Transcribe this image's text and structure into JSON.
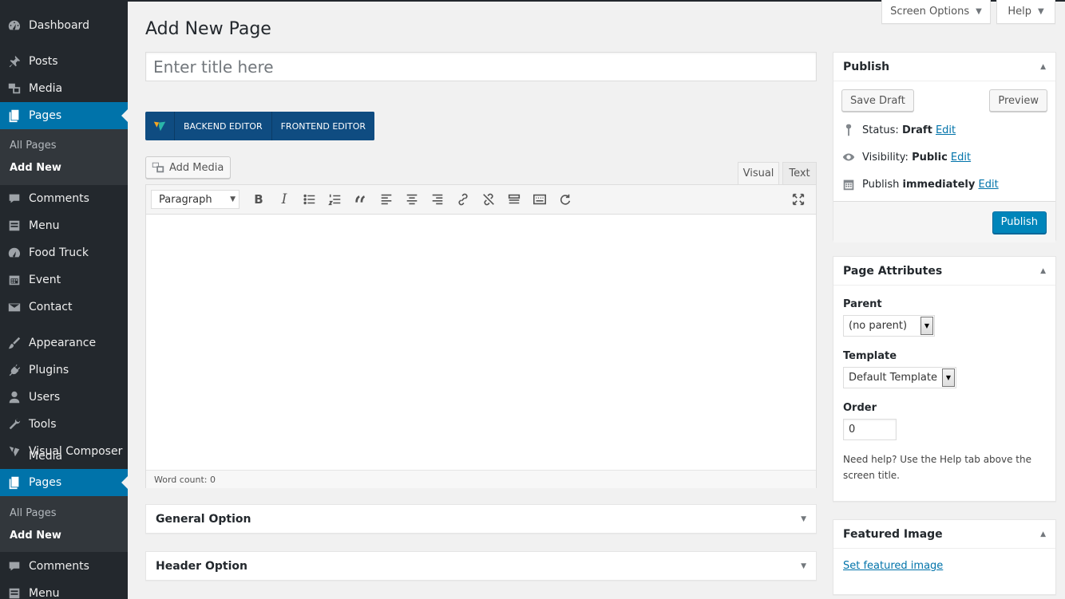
{
  "sidebar": {
    "items": [
      {
        "label": "Dashboard",
        "icon": "dashboard-icon"
      },
      {
        "label": "Posts",
        "icon": "pin-icon"
      },
      {
        "label": "Media",
        "icon": "media-icon"
      },
      {
        "label": "Pages",
        "icon": "pages-icon"
      },
      {
        "label": "Comments",
        "icon": "comment-icon"
      },
      {
        "label": "Menu",
        "icon": "menu-icon"
      },
      {
        "label": "Food Truck",
        "icon": "dashboard-icon"
      },
      {
        "label": "Event",
        "icon": "calendar-icon"
      },
      {
        "label": "Contact",
        "icon": "envelope-icon"
      },
      {
        "label": "Appearance",
        "icon": "paintbrush-icon"
      },
      {
        "label": "Plugins",
        "icon": "plug-icon"
      },
      {
        "label": "Users",
        "icon": "user-icon"
      },
      {
        "label": "Tools",
        "icon": "wrench-icon"
      },
      {
        "label": "Visual Composer",
        "icon": "vc-icon"
      },
      {
        "label": "Media",
        "icon": "media-icon"
      },
      {
        "label": "Pages",
        "icon": "pages-icon"
      },
      {
        "label": "Comments",
        "icon": "comment-icon"
      },
      {
        "label": "Menu",
        "icon": "menu-icon"
      }
    ],
    "submenu": {
      "all_pages": "All Pages",
      "add_new": "Add New"
    }
  },
  "topbar": {
    "screen_options": "Screen Options",
    "help": "Help"
  },
  "page": {
    "title": "Add New Page",
    "title_placeholder": "Enter title here"
  },
  "vc": {
    "backend": "BACKEND EDITOR",
    "frontend": "FRONTEND EDITOR"
  },
  "editor": {
    "add_media": "Add Media",
    "tab_visual": "Visual",
    "tab_text": "Text",
    "format": "Paragraph",
    "bold": "B",
    "italic": "I",
    "word_count": "Word count: 0"
  },
  "meta_boxes": {
    "general": "General Option",
    "header": "Header Option"
  },
  "publish": {
    "title": "Publish",
    "save_draft": "Save Draft",
    "preview": "Preview",
    "status_label": "Status:",
    "status_value": "Draft",
    "visibility_label": "Visibility:",
    "visibility_value": "Public",
    "publish_label": "Publish",
    "publish_value": "immediately",
    "edit": "Edit",
    "publish_button": "Publish"
  },
  "page_attributes": {
    "title": "Page Attributes",
    "parent_label": "Parent",
    "parent_value": "(no parent)",
    "template_label": "Template",
    "template_value": "Default Template",
    "order_label": "Order",
    "order_value": "0",
    "help_text": "Need help? Use the Help tab above the screen title."
  },
  "featured_image": {
    "title": "Featured Image",
    "link": "Set featured image"
  },
  "colors": {
    "sidebar": "#23282d",
    "accent": "#0073aa",
    "vc": "#0f4c81"
  }
}
